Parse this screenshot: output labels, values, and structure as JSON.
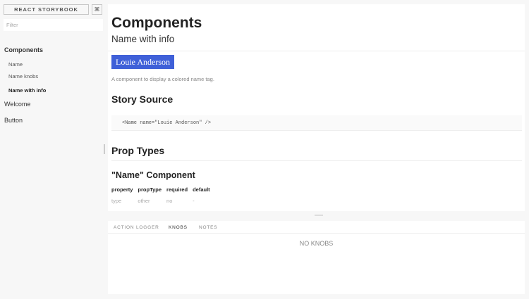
{
  "sidebar": {
    "brand_label": "REACT STORYBOOK",
    "shortcuts_icon": "⌘",
    "filter_placeholder": "Filter",
    "kinds": [
      {
        "label": "Components",
        "stories": [
          "Name",
          "Name knobs",
          "Name with info"
        ]
      },
      {
        "label": "Welcome"
      },
      {
        "label": "Button"
      }
    ],
    "active_story": "Name with info"
  },
  "preview": {
    "title": "Components",
    "subtitle": "Name with info",
    "name_tag": "Louie Anderson",
    "description": "A component to display a colored name tag.",
    "story_source_heading": "Story Source",
    "source_code": "<Name name=\"Louie Anderson\" />",
    "prop_types_heading": "Prop Types",
    "component_heading": "\"Name\" Component",
    "prop_table": {
      "headers": [
        "property",
        "propType",
        "required",
        "default"
      ],
      "rows": [
        [
          "type",
          "other",
          "no",
          "-"
        ]
      ]
    }
  },
  "addons": {
    "tabs": [
      "ACTION LOGGER",
      "KNOBS",
      "NOTES"
    ],
    "active_tab": "KNOBS",
    "empty_message": "NO KNOBS"
  },
  "colors": {
    "name_tag_bg": "#3f60d8",
    "page_bg": "#f7f7f7"
  }
}
